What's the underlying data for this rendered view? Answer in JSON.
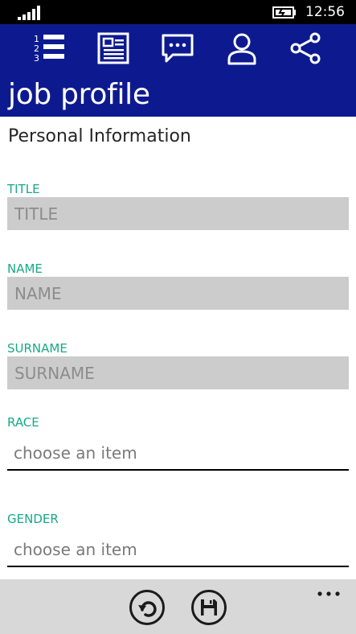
{
  "status_bar": {
    "time": "12:56",
    "signal_icon": "signal-strength-icon",
    "battery_icon": "battery-charging-icon"
  },
  "header": {
    "title": "job profile",
    "nav_icons": [
      "numbered-list-icon",
      "document-icon",
      "chat-bubble-icon",
      "person-icon",
      "share-icon"
    ],
    "background_color": "#0d1a8f"
  },
  "form": {
    "section_title": "Personal Information",
    "fields": {
      "title": {
        "label": "TITLE",
        "placeholder": "TITLE",
        "value": ""
      },
      "name": {
        "label": "NAME",
        "placeholder": "NAME",
        "value": ""
      },
      "surname": {
        "label": "SURNAME",
        "placeholder": "SURNAME",
        "value": ""
      },
      "race": {
        "label": "RACE",
        "value": "choose an item"
      },
      "gender": {
        "label": "GENDER",
        "value": "choose an item"
      }
    },
    "label_color": "#17a987"
  },
  "app_bar": {
    "buttons": [
      "undo-icon",
      "save-icon"
    ],
    "more_icon": "more-ellipsis-icon"
  }
}
